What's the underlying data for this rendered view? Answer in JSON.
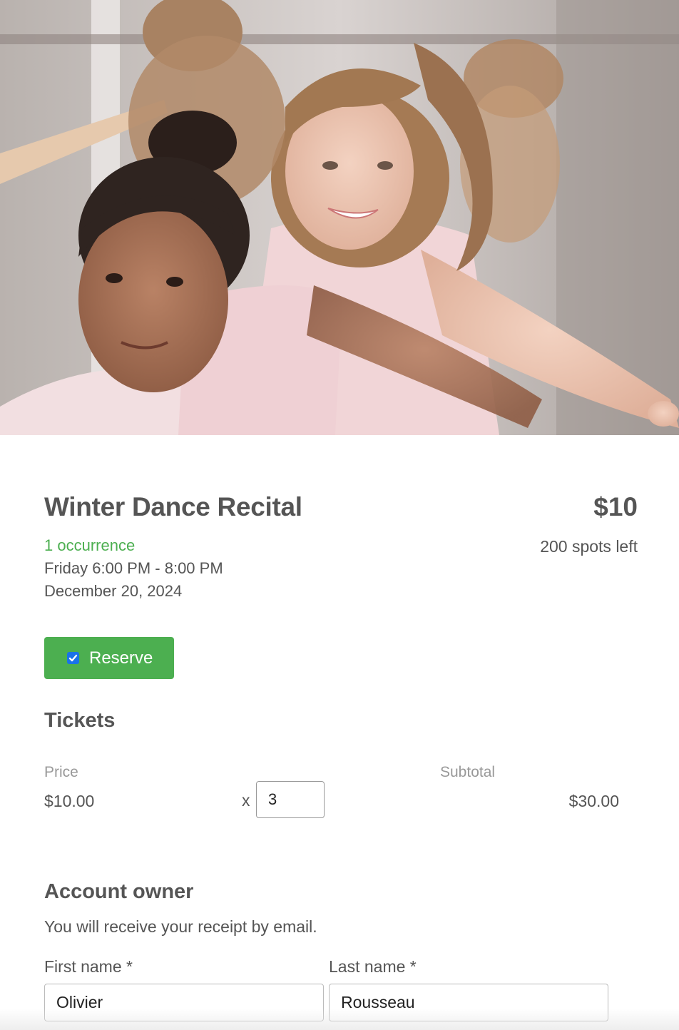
{
  "hero": {
    "image_icon": "ballet-class-photo-icon"
  },
  "event": {
    "title": "Winter Dance Recital",
    "price": "$10",
    "occurrences": "1 occurrence",
    "spots_left": "200 spots left",
    "time": "Friday 6:00 PM - 8:00 PM",
    "date": "December 20, 2024"
  },
  "reserve": {
    "label": "Reserve",
    "checked": true,
    "color": "#4caf50"
  },
  "tickets": {
    "heading": "Tickets",
    "price_label": "Price",
    "subtotal_label": "Subtotal",
    "price_value": "$10.00",
    "times_symbol": "x",
    "quantity": "3",
    "subtotal_value": "$30.00"
  },
  "owner": {
    "heading": "Account owner",
    "note": "You will receive your receipt by email.",
    "first_name_label": "First name *",
    "last_name_label": "Last name *",
    "first_name_value": "Olivier",
    "last_name_value": "Rousseau"
  }
}
